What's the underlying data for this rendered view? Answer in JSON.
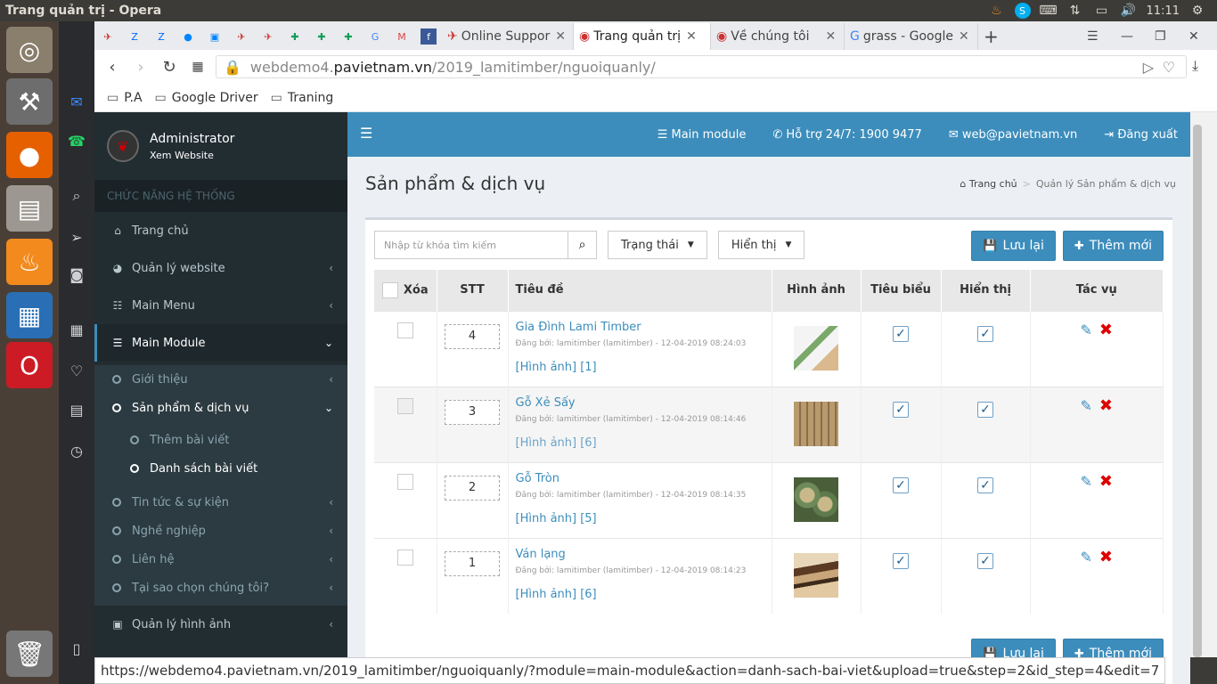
{
  "os": {
    "window_title": "Trang quản trị - Opera",
    "clock": "11:11"
  },
  "browser": {
    "tabs": [
      {
        "label": "Online Suppor",
        "active": false
      },
      {
        "label": "Trang quản trị",
        "active": true
      },
      {
        "label": "Về chúng tôi",
        "active": false
      },
      {
        "label": "grass - Google",
        "active": false
      }
    ],
    "url_prefix": "webdemo4.",
    "url_domain": "pavietnam.vn",
    "url_path": "/2019_lamitimber/nguoiquanly/",
    "bookmarks": [
      "P.A",
      "Google Driver",
      "Traning"
    ],
    "status_url": "https://webdemo4.pavietnam.vn/2019_lamitimber/nguoiquanly/?module=main-module&action=danh-sach-bai-viet&upload=true&step=2&id_step=4&edit=7"
  },
  "sidebar": {
    "user_name": "Administrator",
    "user_link": "Xem Website",
    "section_header": "CHỨC NĂNG HỆ THỐNG",
    "items": [
      {
        "label": "Trang chủ"
      },
      {
        "label": "Quản lý website"
      },
      {
        "label": "Main Menu"
      },
      {
        "label": "Main Module"
      }
    ],
    "submenu": [
      {
        "label": "Giới thiệu"
      },
      {
        "label": "Sản phẩm & dịch vụ"
      },
      {
        "label": "Thêm bài viết"
      },
      {
        "label": "Danh sách bài viết"
      },
      {
        "label": "Tin tức & sự kiện"
      },
      {
        "label": "Nghề nghiệp"
      },
      {
        "label": "Liên hệ"
      },
      {
        "label": "Tại sao chọn chúng tôi?"
      }
    ],
    "last_item": "Quản lý hình ảnh"
  },
  "header": {
    "main_module": "Main module",
    "support": "Hỗ trợ 24/7: 1900 9477",
    "email": "web@pavietnam.vn",
    "logout": "Đăng xuất"
  },
  "page": {
    "title": "Sản phẩm & dịch vụ",
    "crumb_home": "Trang chủ",
    "crumb_current": "Quản lý Sản phẩm & dịch vụ"
  },
  "toolbar": {
    "search_placeholder": "Nhập từ khóa tìm kiếm",
    "status_filter": "Trạng thái",
    "display_filter": "Hiển thị",
    "save_label": "Lưu lại",
    "add_label": "Thêm mới"
  },
  "table": {
    "headers": {
      "delete": "Xóa",
      "stt": "STT",
      "title": "Tiêu đề",
      "image": "Hình ảnh",
      "featured": "Tiêu biểu",
      "visible": "Hiển thị",
      "actions": "Tác vụ"
    },
    "rows": [
      {
        "stt": "4",
        "title": "Gia Đình Lami Timber",
        "byline": "Đăng bởi: lamitimber (lamitimber) - 12-04-2019 08:24:03",
        "images": "[Hình ảnh] [1]"
      },
      {
        "stt": "3",
        "title": "Gỗ Xẻ Sấy",
        "byline": "Đăng bởi: lamitimber (lamitimber) - 12-04-2019 08:14:46",
        "images": "[Hình ảnh] [6]"
      },
      {
        "stt": "2",
        "title": "Gỗ Tròn",
        "byline": "Đăng bởi: lamitimber (lamitimber) - 12-04-2019 08:14:35",
        "images": "[Hình ảnh] [5]"
      },
      {
        "stt": "1",
        "title": "Ván lạng",
        "byline": "Đăng bởi: lamitimber (lamitimber) - 12-04-2019 08:14:23",
        "images": "[Hình ảnh] [6]"
      }
    ]
  },
  "colors": {
    "primary": "#3c8dbc",
    "sidebar_bg": "#222d32",
    "delete_red": "#dd0000"
  }
}
